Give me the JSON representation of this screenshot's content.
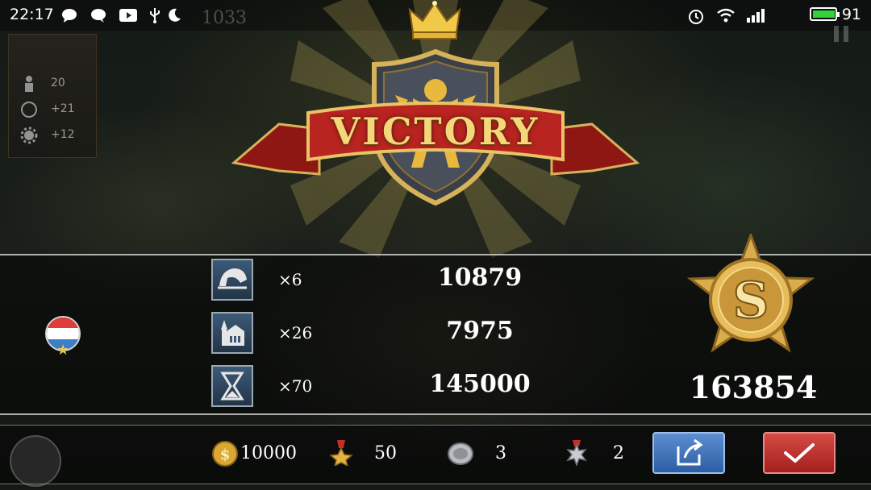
{
  "status_bar": {
    "time": "22:17",
    "battery_level": "91",
    "icons": [
      "message-icon",
      "chat-icon",
      "youtube-icon",
      "usb-icon",
      "moon-icon",
      "alarm-icon",
      "wifi-icon",
      "signal-icon",
      "battery-icon"
    ]
  },
  "background_hud": {
    "turn_number": "1033",
    "side_stats": [
      {
        "icon": "soldier-icon",
        "value": "20"
      },
      {
        "icon": "coin-icon",
        "value": "+21"
      },
      {
        "icon": "gear-icon",
        "value": "+12"
      }
    ]
  },
  "banner": {
    "title": "VICTORY"
  },
  "player": {
    "flag_colors": [
      "#e23b3b",
      "#ffffff",
      "#3d7ec9"
    ]
  },
  "results": [
    {
      "icon": "helmet-icon",
      "count": "×6",
      "value": "10879"
    },
    {
      "icon": "city-building-icon",
      "count": "×26",
      "value": "7975"
    },
    {
      "icon": "hourglass-icon",
      "count": "×70",
      "value": "145000"
    }
  ],
  "rank": {
    "grade": "S",
    "total_score": "163854"
  },
  "rewards": [
    {
      "icon": "gold-coin-icon",
      "value": "10000"
    },
    {
      "icon": "medal-icon",
      "value": "50"
    },
    {
      "icon": "silver-coin-icon",
      "value": "3"
    },
    {
      "icon": "star-badge-icon",
      "value": "2"
    }
  ],
  "buttons": {
    "share_icon": "share-icon",
    "confirm_icon": "checkmark-icon"
  },
  "colors": {
    "gold": "#f3d77a",
    "ribbon_red": "#b8241f",
    "share_blue": "#3e72bb",
    "confirm_red": "#c4302c"
  }
}
